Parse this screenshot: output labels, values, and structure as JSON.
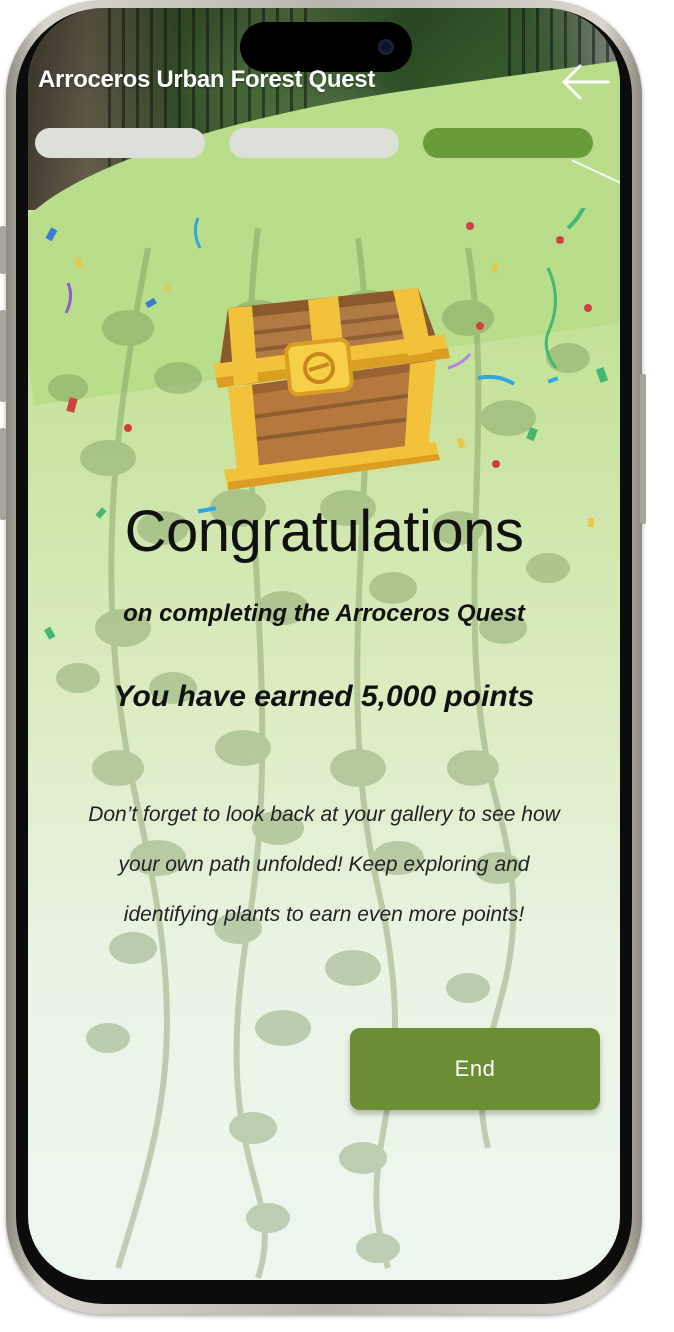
{
  "app": {
    "title": "Arroceros Urban Forest Quest"
  },
  "header": {
    "back_icon": "arrow-left-icon",
    "progress": {
      "steps": [
        {
          "state": "inactive",
          "color": "#dde0d8"
        },
        {
          "state": "inactive",
          "color": "#dde0d8"
        },
        {
          "state": "active",
          "color": "#6b9a3a"
        }
      ]
    }
  },
  "main": {
    "illustration": "treasure-chest-icon",
    "heading": "Congratulations",
    "subtitle": "on completing the Arroceros Quest",
    "points_text": "You have earned 5,000 points",
    "message": "Don’t forget to look back at your gallery to see how your own path unfolded! Keep exploring and identifying plants to earn even more points!",
    "end_label": "End"
  },
  "colors": {
    "accent": "#6b8e34",
    "background_top": "#b9dd8a",
    "background_bottom": "#edf7f0"
  }
}
